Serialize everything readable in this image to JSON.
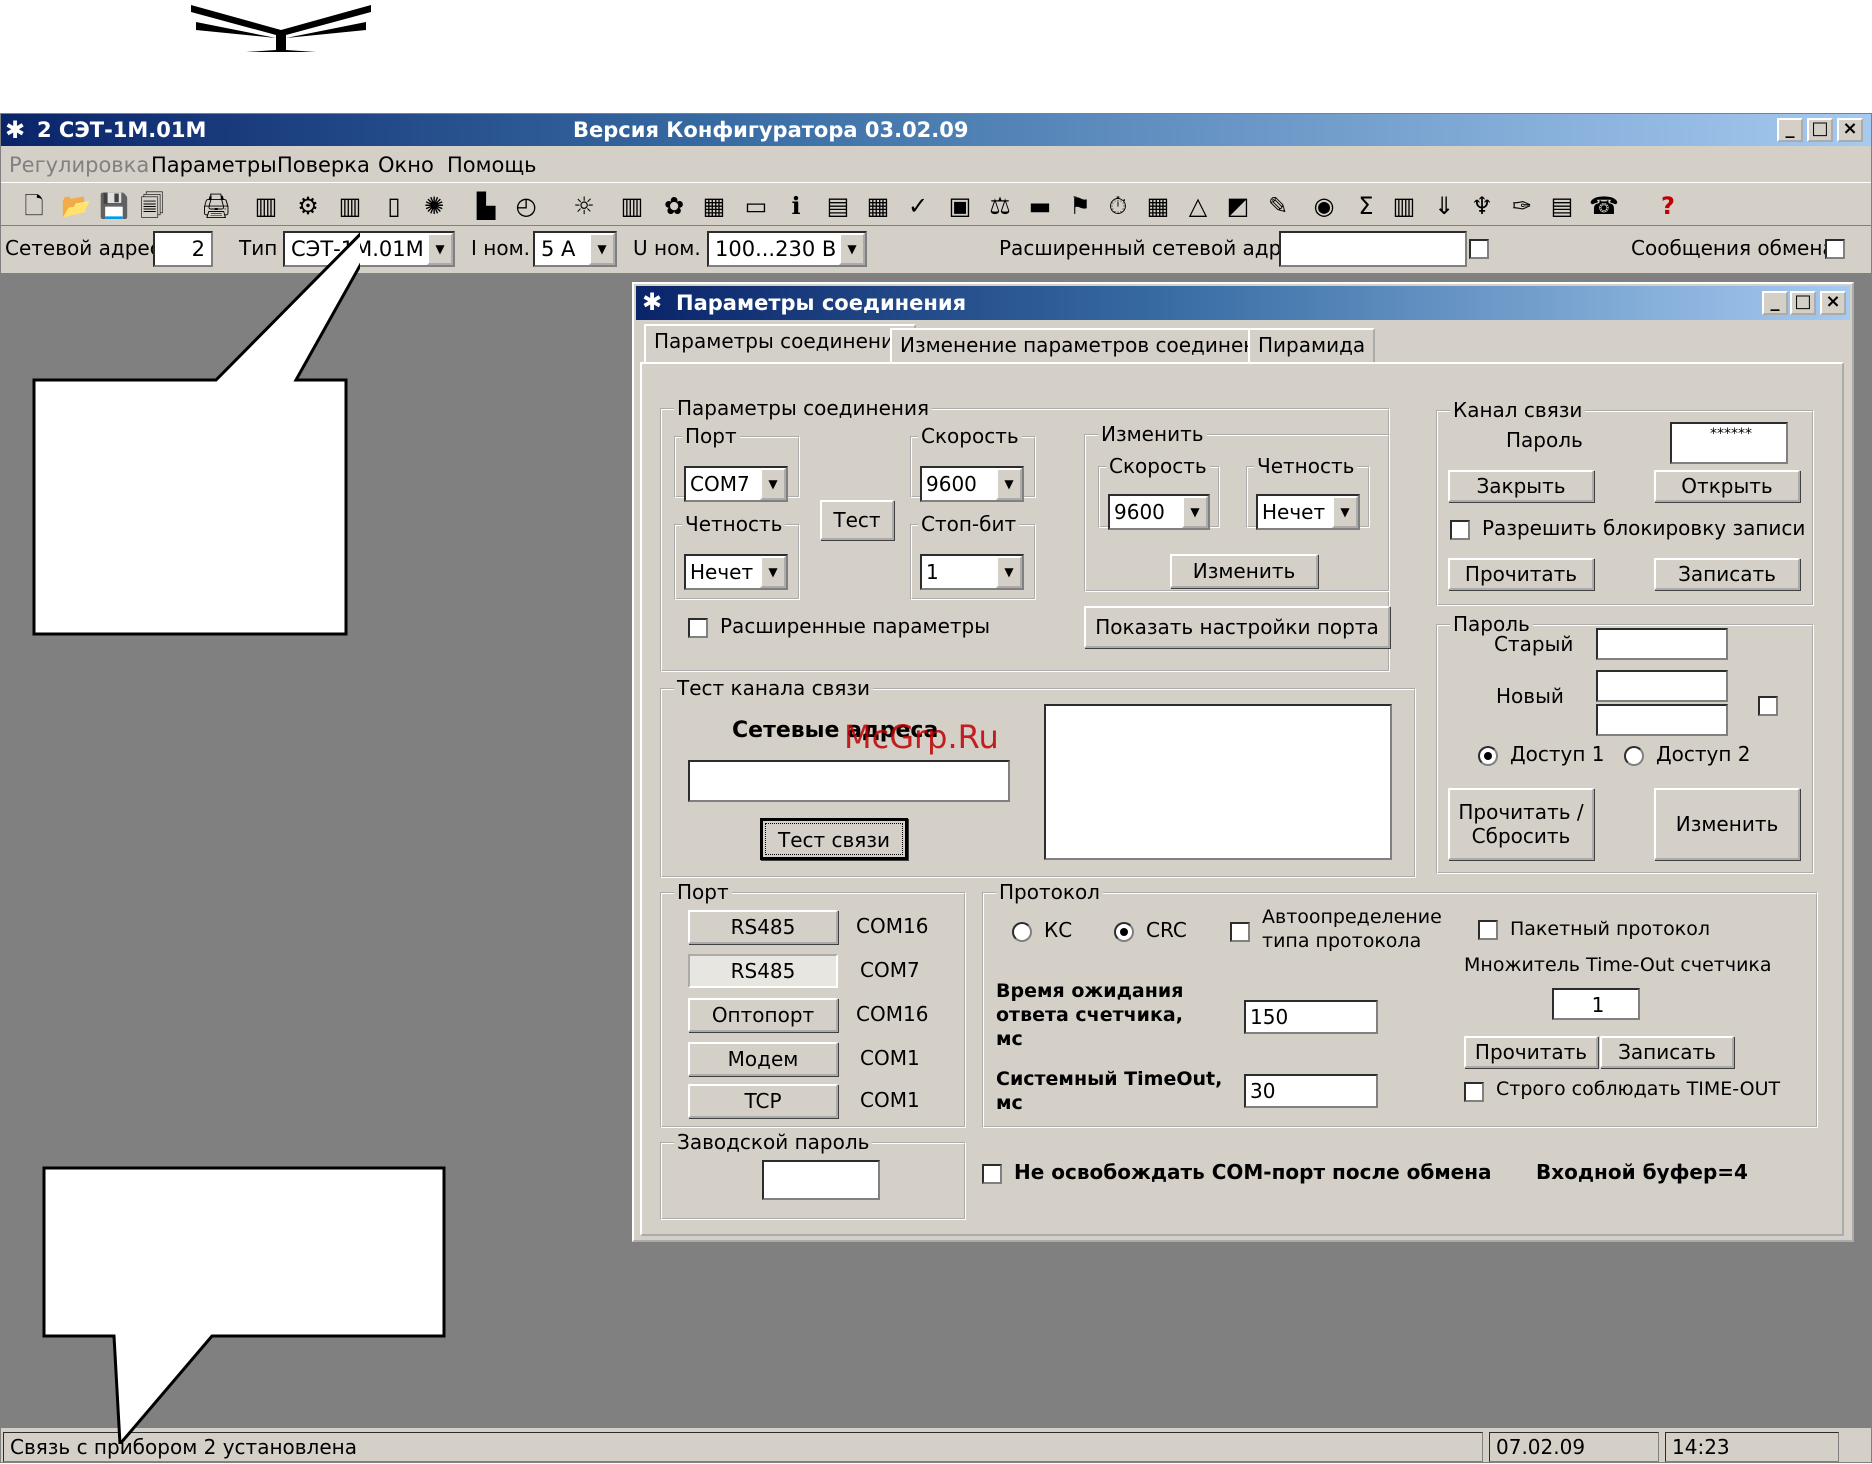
{
  "window": {
    "title_left": "2  СЭТ-1М.01М",
    "title_center": "Версия Конфигуратора  03.02.09",
    "buttons": [
      "_",
      "□",
      "×"
    ]
  },
  "menu": [
    "Регулировка",
    "Параметры",
    "Поверка",
    "Окно",
    "Помощь"
  ],
  "addrbar": {
    "net_label": "Сетевой адрес",
    "net_value": "2",
    "type_label": "Тип",
    "type_value": "СЭТ-1М.01М",
    "inom_label": "I ном.",
    "inom_value": "5 А",
    "unom_label": "U ном.",
    "unom_value": "100...230 В",
    "ext_label": "Расширенный сетевой адрес",
    "exch_label": "Сообщения обмена"
  },
  "status": {
    "message": "Связь с прибором 2 установлена",
    "date": "07.02.09",
    "time": "14:23"
  },
  "dialog": {
    "title": "Параметры соединения",
    "tabs": [
      "Параметры соединения",
      "Изменение параметров соединения",
      "Пирамида"
    ],
    "conn": {
      "legend": "Параметры соединения",
      "port_label": "Порт",
      "port_value": "COM7",
      "speed_label": "Скорость",
      "speed_value": "9600",
      "parity_label": "Четность",
      "parity_value": "Нечет",
      "stop_label": "Стоп-бит",
      "stop_value": "1",
      "test_btn": "Тест",
      "ext_params": "Расширенные параметры",
      "show_port_btn": "Показать настройки порта",
      "change_legend": "Изменить",
      "change_speed_label": "Скорость",
      "change_speed_value": "9600",
      "change_parity_label": "Четность",
      "change_parity_value": "Нечет",
      "change_btn": "Изменить"
    },
    "channel": {
      "legend": "Канал связи",
      "password_label": "Пароль",
      "password_value": "******",
      "close_btn": "Закрыть",
      "open_btn": "Открыть",
      "allow_lock": "Разрешить блокировку записи",
      "read_btn": "Прочитать",
      "write_btn": "Записать"
    },
    "password": {
      "legend": "Пароль",
      "old_label": "Старый",
      "new_label": "Новый",
      "access1": "Доступ 1",
      "access2": "Доступ 2",
      "read_reset_btn_1": "Прочитать /",
      "read_reset_btn_2": "Сбросить",
      "change_btn": "Изменить"
    },
    "test": {
      "legend": "Тест канала связи",
      "net_addr_label": "Сетевые адреса",
      "watermark": "McGrp.Ru",
      "test_btn": "Тест связи"
    },
    "port_group": {
      "legend": "Порт",
      "rows": [
        {
          "btn": "RS485",
          "com": "COM16"
        },
        {
          "btn": "RS485",
          "com": "COM7"
        },
        {
          "btn": "Оптопорт",
          "com": "COM16"
        },
        {
          "btn": "Модем",
          "com": "COM1"
        },
        {
          "btn": "TCP",
          "com": "COM1"
        }
      ]
    },
    "protocol": {
      "legend": "Протокол",
      "kc": "КС",
      "crc": "CRC",
      "auto_1": "Автоопределение",
      "auto_2": "типа протокола",
      "packet": "Пакетный протокол",
      "mult_label": "Множитель Time-Out счетчика",
      "mult_value": "1",
      "wait_1": "Время ожидания",
      "wait_2": "ответа счетчика,",
      "wait_3": "мс",
      "wait_value": "150",
      "sys_1": "Системный TimeOut,",
      "sys_2": "мс",
      "sys_value": "30",
      "read_btn": "Прочитать",
      "write_btn": "Записать",
      "strict": "Строго соблюдать TIME-OUT"
    },
    "factory": {
      "legend": "Заводской пароль"
    },
    "no_release": "Не освобождать СОМ-порт после обмена",
    "input_buffer": "Входной буфер=4"
  },
  "icons": [
    "new-file-icon",
    "open-folder-icon",
    "save-icon",
    "save-all-icon",
    "print-icon",
    "meter-icon",
    "settings-icon",
    "connect-icon",
    "device-icon",
    "star-icon",
    "chart-icon",
    "clock-icon",
    "lamp-icon",
    "bar-chart-icon",
    "palette-icon",
    "map-icon",
    "window-icon",
    "info-icon",
    "list-icon",
    "table-icon",
    "check-icon",
    "monitor-icon",
    "scale-icon",
    "computer-icon",
    "flag-icon",
    "timer-icon",
    "calendar-icon",
    "delta-icon",
    "graph-icon",
    "tools-icon",
    "globe-icon",
    "sum-icon",
    "folder-icon",
    "download-icon",
    "tree-icon",
    "wizard-icon",
    "export-icon",
    "phone-icon",
    "help-icon"
  ]
}
